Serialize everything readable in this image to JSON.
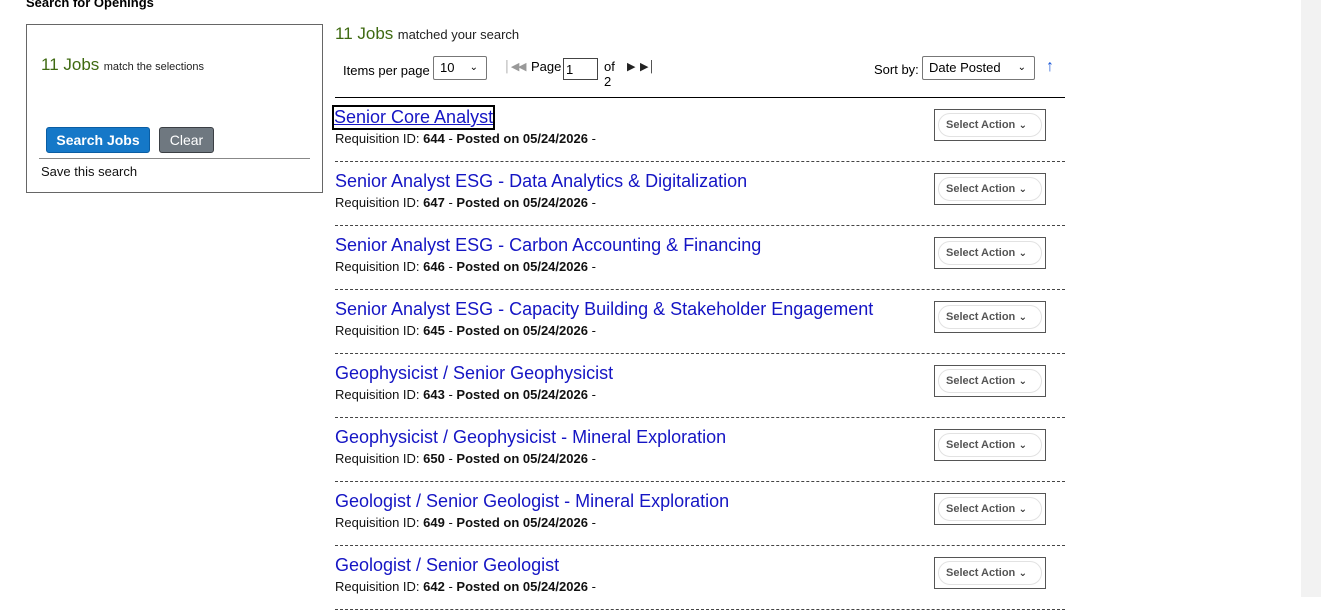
{
  "page": {
    "heading": "Search for Openings"
  },
  "sidebar": {
    "count": "11 Jobs",
    "count_suffix": "match the selections",
    "search_button": "Search Jobs",
    "clear_button": "Clear",
    "save_search": "Save this search"
  },
  "results": {
    "count": "11 Jobs",
    "count_suffix": "matched your search",
    "items_per_page_label": "Items per page",
    "items_per_page_value": "10",
    "page_label": "Page",
    "page_value": "1",
    "page_of": "of 2",
    "sort_label": "Sort by:",
    "sort_value": "Date Posted",
    "sort_direction_icon": "↑"
  },
  "labels": {
    "requisition_prefix": "Requisition ID: ",
    "posted_prefix": "Posted on ",
    "select_action": "Select Action"
  },
  "jobs": [
    {
      "title": "Senior Core Analyst",
      "req_id": "644",
      "posted": "05/24/2026"
    },
    {
      "title": "Senior Analyst ESG - Data Analytics & Digitalization",
      "req_id": "647",
      "posted": "05/24/2026"
    },
    {
      "title": "Senior Analyst ESG - Carbon Accounting & Financing",
      "req_id": "646",
      "posted": "05/24/2026"
    },
    {
      "title": "Senior Analyst ESG - Capacity Building & Stakeholder Engagement",
      "req_id": "645",
      "posted": "05/24/2026"
    },
    {
      "title": "Geophysicist / Senior Geophysicist",
      "req_id": "643",
      "posted": "05/24/2026"
    },
    {
      "title": "Geophysicist / Geophysicist - Mineral Exploration",
      "req_id": "650",
      "posted": "05/24/2026"
    },
    {
      "title": "Geologist / Senior Geologist - Mineral Exploration",
      "req_id": "649",
      "posted": "05/24/2026"
    },
    {
      "title": "Geologist / Senior Geologist",
      "req_id": "642",
      "posted": "05/24/2026"
    }
  ],
  "colors": {
    "link": "#1515c4",
    "count": "#3f6a12",
    "primary_button": "#1578c8",
    "secondary_button": "#6f7880"
  }
}
